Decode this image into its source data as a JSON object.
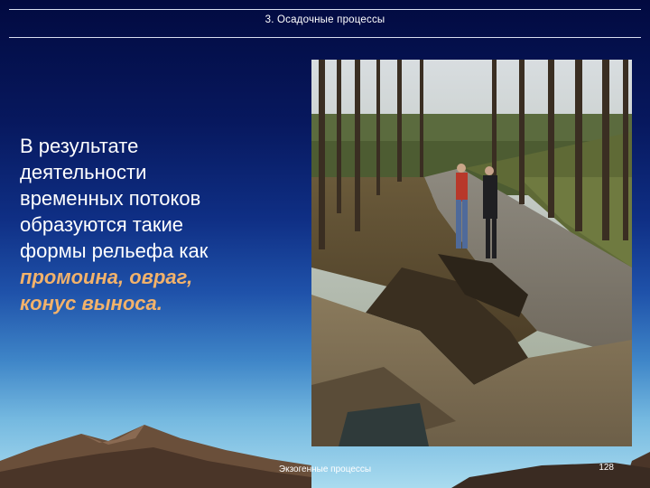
{
  "header": {
    "title": "3.  Осадочные процессы"
  },
  "content": {
    "lines": [
      "В результате",
      "деятельности",
      "временных потоков",
      "образуются такие",
      "формы рельефа как"
    ],
    "highlight_lines": [
      "промоина, овраг,",
      "конус выноса."
    ]
  },
  "footer": {
    "text": "Экзогенные процессы",
    "page": "128"
  },
  "colors": {
    "highlight": "#f2b26b",
    "text": "#ffffff",
    "background_top": "#020a40",
    "background_bottom": "#a9dbef"
  }
}
